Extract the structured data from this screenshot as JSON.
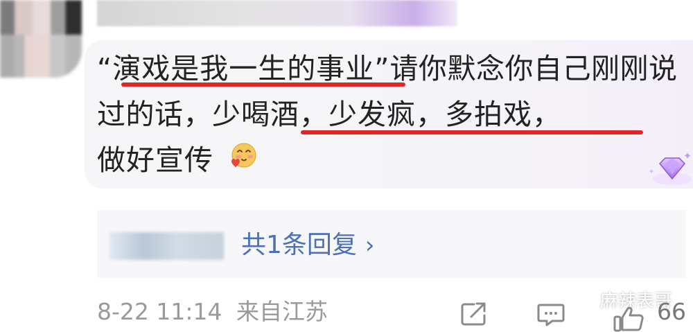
{
  "comment": {
    "open_quote": "“",
    "highlight_1": "演戏是我一生的事业",
    "close_quote": "”",
    "text_mid": "请你默念你自己刚刚说过的话，",
    "highlight_2": "少喝酒，少发疯，多拍戏，",
    "text_end": "做好宣传",
    "emoji_icon": "blushing-heart-emoji-icon",
    "underline_color": "#e02727"
  },
  "replies": {
    "label": "共1条回复",
    "chevron": "›",
    "link_color": "#4a71b7"
  },
  "footer": {
    "timestamp": "8-22 11:14",
    "location": "来自江苏",
    "like_count": "66"
  },
  "watermark": {
    "text": "麻辣表哥"
  }
}
